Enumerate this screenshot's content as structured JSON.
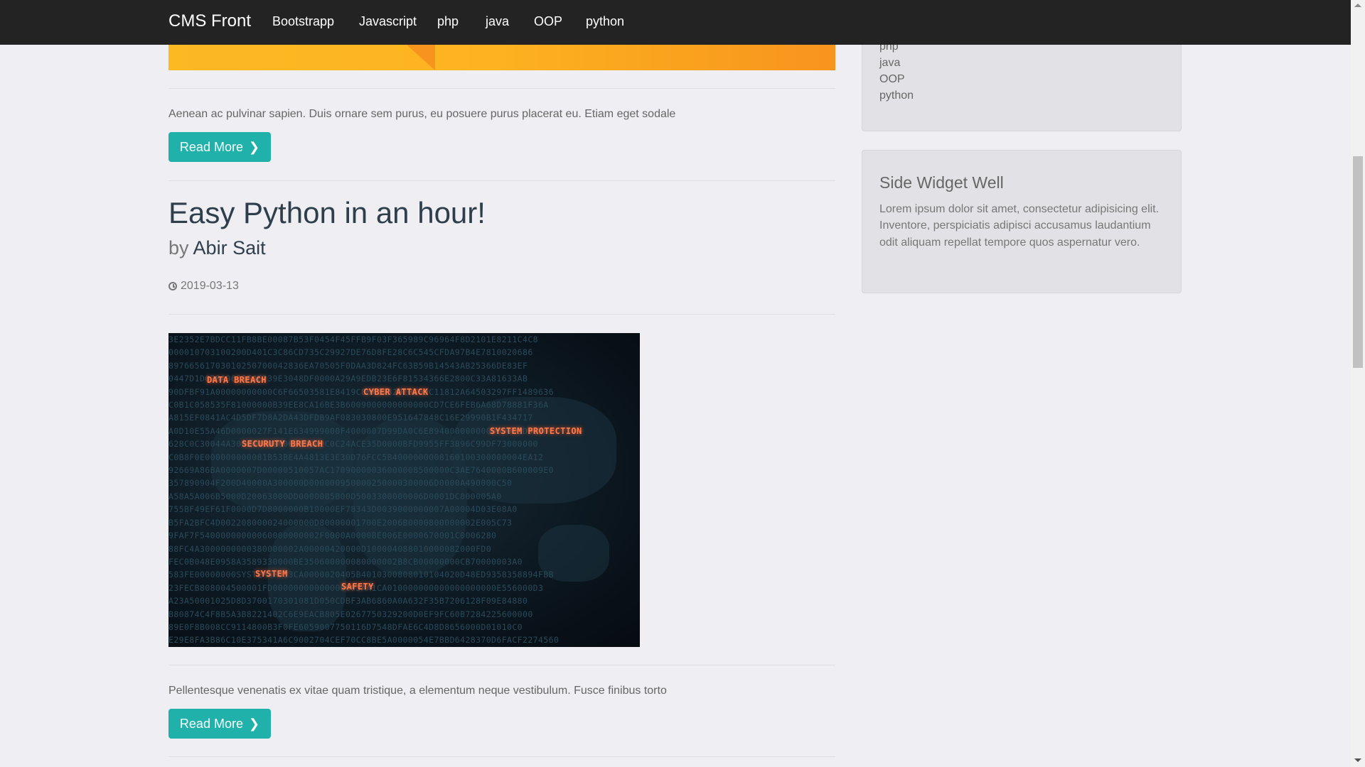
{
  "navbar": {
    "brand": "CMS Front",
    "items": [
      "Bootstrapp",
      "Javascript",
      "php",
      "java",
      "OOP",
      "python"
    ]
  },
  "posts": [
    {
      "excerpt": "Aenean ac pulvinar sapien. Duis ornare sem purus, eu posuere purus placerat eu. Etiam eget sodale",
      "read_more": "Read More"
    },
    {
      "title": "Easy Python in an hour!",
      "by": "by",
      "author": "Abir Sait",
      "date": "2019-03-13",
      "image_labels": {
        "orange": [
          "DATA BREACH",
          "CYBER ATTACK",
          "SYSTEM PROTECTION",
          "SECURUTY BREACH",
          "SYSTEM",
          "SAFETY"
        ]
      },
      "excerpt": "Pellentesque venenatis ex vitae quam tristique, a elementum neque vestibulum. Fusce finibus torto",
      "read_more": "Read More"
    }
  ],
  "sidebar": {
    "categories": [
      "php",
      "java",
      "OOP",
      "python"
    ],
    "widget": {
      "title": "Side Widget Well",
      "text": "Lorem ipsum dolor sit amet, consectetur adipisicing elit. Inventore, perspiciatis adipisci accusamus laudantium odit aliquam repellat tempore quos aspernatur vero."
    }
  },
  "colors": {
    "navbar": "#232323",
    "accent": "#20b2aa",
    "banner": "#fdb320"
  }
}
